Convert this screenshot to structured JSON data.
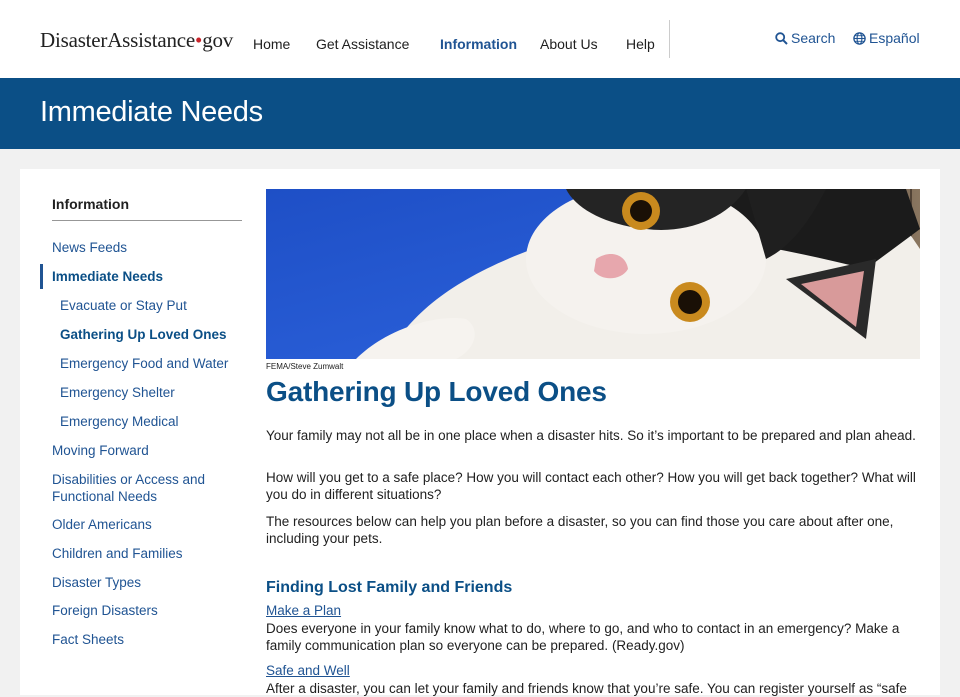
{
  "header": {
    "logo_main": "DisasterAssistance",
    "logo_dot": "•",
    "logo_gov": "gov",
    "nav": [
      {
        "label": "Home"
      },
      {
        "label": "Get Assistance"
      },
      {
        "label": "Information"
      },
      {
        "label": "About Us"
      },
      {
        "label": "Help"
      }
    ],
    "search_label": "Search",
    "language_label": "Español"
  },
  "banner": {
    "title": "Immediate Needs"
  },
  "sidebar": {
    "heading": "Information",
    "items": [
      {
        "label": "News Feeds"
      },
      {
        "label": "Immediate Needs"
      },
      {
        "label": "Evacuate or Stay Put"
      },
      {
        "label": "Gathering Up Loved Ones"
      },
      {
        "label": "Emergency Food and Water"
      },
      {
        "label": "Emergency Shelter"
      },
      {
        "label": "Emergency Medical"
      },
      {
        "label": "Moving Forward"
      },
      {
        "label": "Disabilities or Access and Functional Needs"
      },
      {
        "label": "Older Americans"
      },
      {
        "label": "Children and Families"
      },
      {
        "label": "Disaster Types"
      },
      {
        "label": "Foreign Disasters"
      },
      {
        "label": "Fact Sheets"
      }
    ]
  },
  "main": {
    "image_credit": "FEMA/Steve Zumwalt",
    "title": "Gathering Up Loved Ones",
    "paragraphs": [
      "Your family may not all be in one place when a disaster hits. So it’s important to be prepared and plan ahead.",
      "How will you get to a safe place? How you will contact each other? How you will get back together? What will you do in different situations?",
      "The resources below can help you plan before a disaster, so you can find those you care about after one, including your pets."
    ],
    "section_heading": "Finding Lost Family and Friends",
    "resources": [
      {
        "link": "Make a Plan",
        "text": "Does everyone in your family know what to do, where to go, and who to contact in an emergency? Make a family communication plan so everyone can be prepared. (Ready.gov)"
      },
      {
        "link": "Safe and Well",
        "text": "After a disaster, you can let your family and friends know that you’re safe. You can register yourself as “safe"
      }
    ]
  },
  "colors": {
    "brand_blue": "#0b4f86",
    "link_blue": "#205493",
    "logo_dot_red": "#c9252c"
  }
}
